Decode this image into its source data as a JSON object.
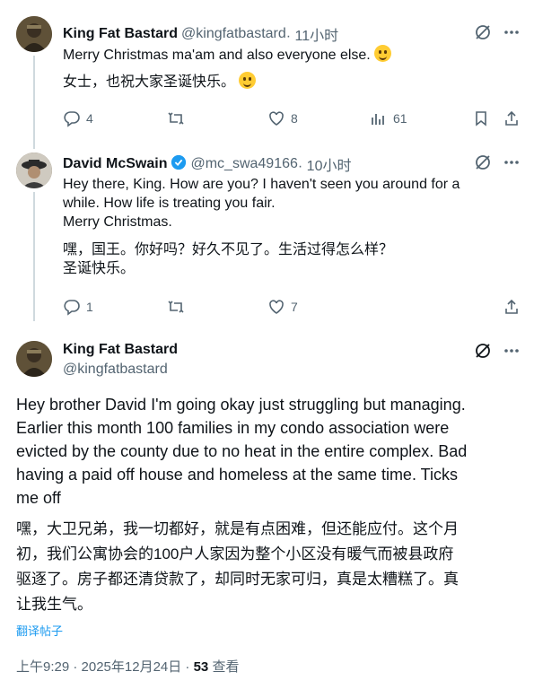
{
  "tweets": [
    {
      "name": "King Fat Bastard",
      "handle": "@kingfatbastard",
      "time": " · 11小时",
      "text": "Merry Christmas ma'am and also everyone else.",
      "translation": "女士，也祝大家圣诞快乐。",
      "replies": "4",
      "retweets": "",
      "likes": "8",
      "views": "61"
    },
    {
      "name": "David McSwain",
      "handle": "@mc_swa49166",
      "time": " · 10小时",
      "text_lines": [
        "Hey there, King. How are you? I haven't seen you around for a",
        "while. How life is treating you fair.",
        "Merry Christmas."
      ],
      "translation_lines": [
        "嘿，国王。你好吗？好久不见了。生活过得怎么样？",
        "圣诞快乐。"
      ],
      "replies": "1",
      "retweets": "",
      "likes": "7"
    }
  ],
  "main_post": {
    "name": "King Fat Bastard",
    "handle": "@kingfatbastard",
    "text_lines": [
      "Hey brother David I'm going okay just struggling but managing.",
      "Earlier this month 100 families in my condo association were",
      "evicted by the county due to no heat in the entire complex. Bad",
      "having a paid off house and homeless at the same time. Ticks",
      "me off"
    ],
    "translation_lines": [
      "嘿，大卫兄弟，我一切都好，就是有点困难，但还能应付。这个月",
      "初，我们公寓协会的100户人家因为整个小区没有暖气而被县政府",
      "驱逐了。房子都还清贷款了，却同时无家可归，真是太糟糕了。真",
      "让我生气。"
    ],
    "translate_label": "翻译帖子",
    "timestamp": "上午9:29 · 2025年12月24日 · ",
    "views_count": "53",
    "views_label": " 查看"
  },
  "colors": {
    "accent": "#1d9bf0",
    "secondary_text": "#536471",
    "line": "#cfd9de"
  },
  "icons": [
    "grok-icon",
    "more-icon",
    "reply-icon",
    "retweet-icon",
    "like-icon",
    "views-icon",
    "bookmark-icon",
    "share-icon",
    "verified-badge-icon"
  ]
}
